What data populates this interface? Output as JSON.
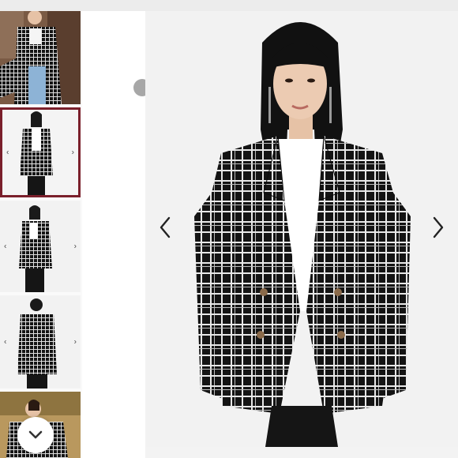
{
  "gallery": {
    "thumbnails": [
      {
        "name": "street-photo",
        "active": false
      },
      {
        "name": "front-view",
        "active": true
      },
      {
        "name": "side-view",
        "active": false
      },
      {
        "name": "back-view",
        "active": false
      },
      {
        "name": "outdoor-photo",
        "active": false
      }
    ],
    "main_image": "model-wearing-black-white-plaid-double-breasted-blazer",
    "icons": {
      "prev": "chevron-left-icon",
      "next": "chevron-right-icon",
      "scroll": "chevron-down-icon"
    },
    "colors": {
      "active_border": "#7a1f2b",
      "plaid_black": "#141414",
      "plaid_white": "#f2f2f2"
    }
  }
}
